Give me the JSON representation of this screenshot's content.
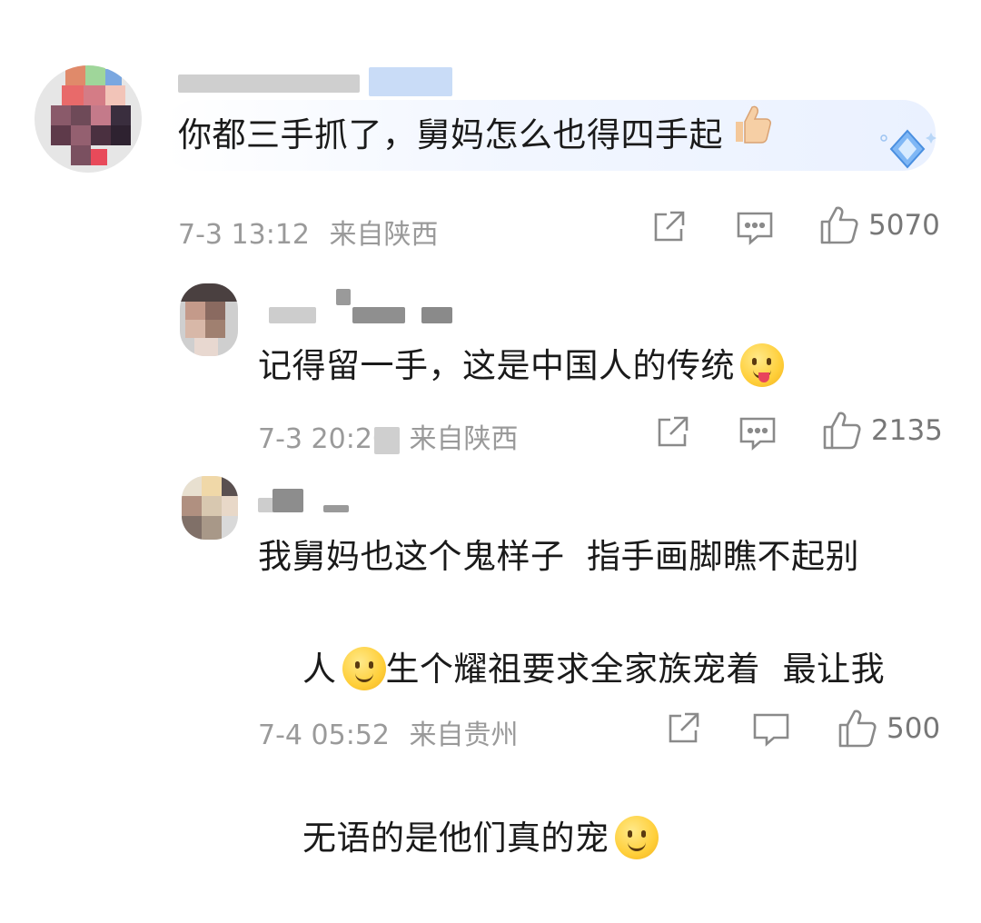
{
  "comments": [
    {
      "text": "你都三手抓了，舅妈怎么也得四手起",
      "emoji": "thumbs-up",
      "time": "7-3 13:12",
      "location": "来自陕西",
      "likes": "5070"
    },
    {
      "text": "记得留一手，这是中国人的传统",
      "emoji": "tongue-out-face",
      "time": "7-3 20:20",
      "location": "来自陕西",
      "likes": "2135"
    },
    {
      "line1": "我舅妈也这个鬼样子  指手画脚瞧不起别",
      "line2a": "人",
      "line2b": "生个耀祖要求全家族宠着  最让我",
      "line3": "无语的是他们真的宠",
      "emoji": "smile-face",
      "time": "7-4 05:52",
      "location": "来自贵州",
      "likes": "500"
    }
  ],
  "icons": [
    "share-icon",
    "reply-icon",
    "like-icon",
    "diamond-badge-icon"
  ],
  "colors": {
    "meta_gray": "#9a9a9a",
    "text": "#1a1a1a",
    "badge_blue": "#5aa4ff"
  }
}
